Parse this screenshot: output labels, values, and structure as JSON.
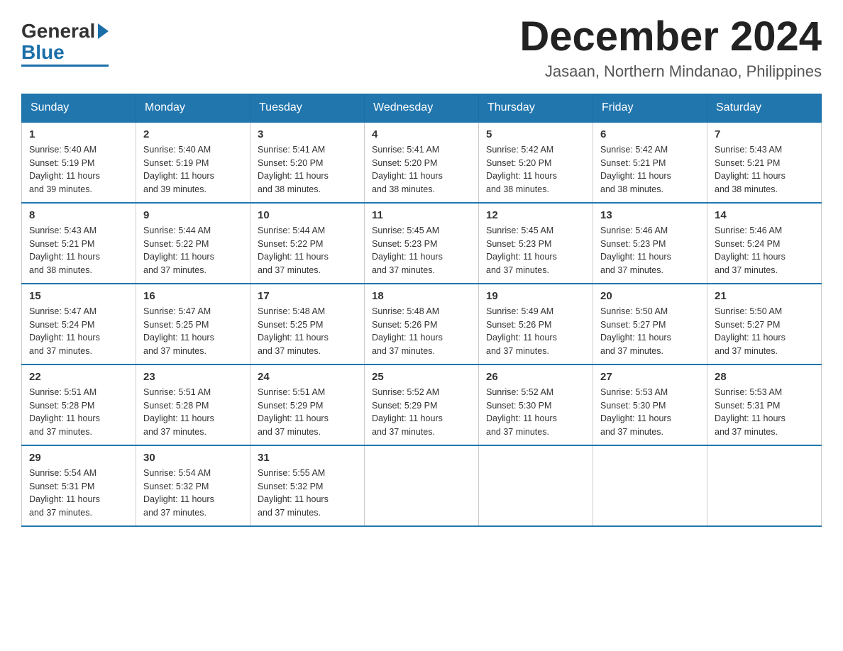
{
  "header": {
    "logo_general": "General",
    "logo_blue": "Blue",
    "month_title": "December 2024",
    "location": "Jasaan, Northern Mindanao, Philippines"
  },
  "weekdays": [
    "Sunday",
    "Monday",
    "Tuesday",
    "Wednesday",
    "Thursday",
    "Friday",
    "Saturday"
  ],
  "weeks": [
    [
      {
        "day": "1",
        "sunrise": "5:40 AM",
        "sunset": "5:19 PM",
        "daylight": "11 hours and 39 minutes."
      },
      {
        "day": "2",
        "sunrise": "5:40 AM",
        "sunset": "5:19 PM",
        "daylight": "11 hours and 39 minutes."
      },
      {
        "day": "3",
        "sunrise": "5:41 AM",
        "sunset": "5:20 PM",
        "daylight": "11 hours and 38 minutes."
      },
      {
        "day": "4",
        "sunrise": "5:41 AM",
        "sunset": "5:20 PM",
        "daylight": "11 hours and 38 minutes."
      },
      {
        "day": "5",
        "sunrise": "5:42 AM",
        "sunset": "5:20 PM",
        "daylight": "11 hours and 38 minutes."
      },
      {
        "day": "6",
        "sunrise": "5:42 AM",
        "sunset": "5:21 PM",
        "daylight": "11 hours and 38 minutes."
      },
      {
        "day": "7",
        "sunrise": "5:43 AM",
        "sunset": "5:21 PM",
        "daylight": "11 hours and 38 minutes."
      }
    ],
    [
      {
        "day": "8",
        "sunrise": "5:43 AM",
        "sunset": "5:21 PM",
        "daylight": "11 hours and 38 minutes."
      },
      {
        "day": "9",
        "sunrise": "5:44 AM",
        "sunset": "5:22 PM",
        "daylight": "11 hours and 37 minutes."
      },
      {
        "day": "10",
        "sunrise": "5:44 AM",
        "sunset": "5:22 PM",
        "daylight": "11 hours and 37 minutes."
      },
      {
        "day": "11",
        "sunrise": "5:45 AM",
        "sunset": "5:23 PM",
        "daylight": "11 hours and 37 minutes."
      },
      {
        "day": "12",
        "sunrise": "5:45 AM",
        "sunset": "5:23 PM",
        "daylight": "11 hours and 37 minutes."
      },
      {
        "day": "13",
        "sunrise": "5:46 AM",
        "sunset": "5:23 PM",
        "daylight": "11 hours and 37 minutes."
      },
      {
        "day": "14",
        "sunrise": "5:46 AM",
        "sunset": "5:24 PM",
        "daylight": "11 hours and 37 minutes."
      }
    ],
    [
      {
        "day": "15",
        "sunrise": "5:47 AM",
        "sunset": "5:24 PM",
        "daylight": "11 hours and 37 minutes."
      },
      {
        "day": "16",
        "sunrise": "5:47 AM",
        "sunset": "5:25 PM",
        "daylight": "11 hours and 37 minutes."
      },
      {
        "day": "17",
        "sunrise": "5:48 AM",
        "sunset": "5:25 PM",
        "daylight": "11 hours and 37 minutes."
      },
      {
        "day": "18",
        "sunrise": "5:48 AM",
        "sunset": "5:26 PM",
        "daylight": "11 hours and 37 minutes."
      },
      {
        "day": "19",
        "sunrise": "5:49 AM",
        "sunset": "5:26 PM",
        "daylight": "11 hours and 37 minutes."
      },
      {
        "day": "20",
        "sunrise": "5:50 AM",
        "sunset": "5:27 PM",
        "daylight": "11 hours and 37 minutes."
      },
      {
        "day": "21",
        "sunrise": "5:50 AM",
        "sunset": "5:27 PM",
        "daylight": "11 hours and 37 minutes."
      }
    ],
    [
      {
        "day": "22",
        "sunrise": "5:51 AM",
        "sunset": "5:28 PM",
        "daylight": "11 hours and 37 minutes."
      },
      {
        "day": "23",
        "sunrise": "5:51 AM",
        "sunset": "5:28 PM",
        "daylight": "11 hours and 37 minutes."
      },
      {
        "day": "24",
        "sunrise": "5:51 AM",
        "sunset": "5:29 PM",
        "daylight": "11 hours and 37 minutes."
      },
      {
        "day": "25",
        "sunrise": "5:52 AM",
        "sunset": "5:29 PM",
        "daylight": "11 hours and 37 minutes."
      },
      {
        "day": "26",
        "sunrise": "5:52 AM",
        "sunset": "5:30 PM",
        "daylight": "11 hours and 37 minutes."
      },
      {
        "day": "27",
        "sunrise": "5:53 AM",
        "sunset": "5:30 PM",
        "daylight": "11 hours and 37 minutes."
      },
      {
        "day": "28",
        "sunrise": "5:53 AM",
        "sunset": "5:31 PM",
        "daylight": "11 hours and 37 minutes."
      }
    ],
    [
      {
        "day": "29",
        "sunrise": "5:54 AM",
        "sunset": "5:31 PM",
        "daylight": "11 hours and 37 minutes."
      },
      {
        "day": "30",
        "sunrise": "5:54 AM",
        "sunset": "5:32 PM",
        "daylight": "11 hours and 37 minutes."
      },
      {
        "day": "31",
        "sunrise": "5:55 AM",
        "sunset": "5:32 PM",
        "daylight": "11 hours and 37 minutes."
      },
      null,
      null,
      null,
      null
    ]
  ],
  "labels": {
    "sunrise": "Sunrise:",
    "sunset": "Sunset:",
    "daylight": "Daylight:"
  }
}
